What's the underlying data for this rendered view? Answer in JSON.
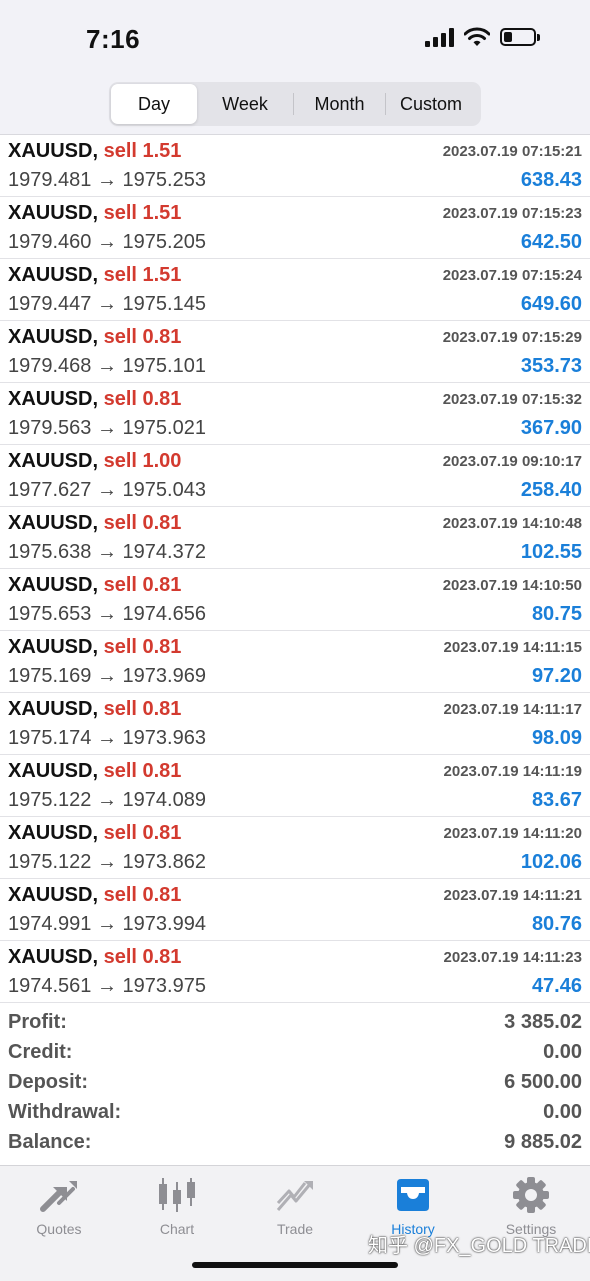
{
  "status_bar": {
    "time": "7:16"
  },
  "segments": {
    "tabs": [
      "Day",
      "Week",
      "Month",
      "Custom"
    ],
    "selected": "Day"
  },
  "trades": [
    {
      "symbol": "XAUUSD,",
      "side": "sell 1.51",
      "prices": "1979.481 → 1975.253",
      "datetime": "2023.07.19 07:15:21",
      "profit": "638.43"
    },
    {
      "symbol": "XAUUSD,",
      "side": "sell 1.51",
      "prices": "1979.460 → 1975.205",
      "datetime": "2023.07.19 07:15:23",
      "profit": "642.50"
    },
    {
      "symbol": "XAUUSD,",
      "side": "sell 1.51",
      "prices": "1979.447 → 1975.145",
      "datetime": "2023.07.19 07:15:24",
      "profit": "649.60"
    },
    {
      "symbol": "XAUUSD,",
      "side": "sell 0.81",
      "prices": "1979.468 → 1975.101",
      "datetime": "2023.07.19 07:15:29",
      "profit": "353.73"
    },
    {
      "symbol": "XAUUSD,",
      "side": "sell 0.81",
      "prices": "1979.563 → 1975.021",
      "datetime": "2023.07.19 07:15:32",
      "profit": "367.90"
    },
    {
      "symbol": "XAUUSD,",
      "side": "sell 1.00",
      "prices": "1977.627 → 1975.043",
      "datetime": "2023.07.19 09:10:17",
      "profit": "258.40"
    },
    {
      "symbol": "XAUUSD,",
      "side": "sell 0.81",
      "prices": "1975.638 → 1974.372",
      "datetime": "2023.07.19 14:10:48",
      "profit": "102.55"
    },
    {
      "symbol": "XAUUSD,",
      "side": "sell 0.81",
      "prices": "1975.653 → 1974.656",
      "datetime": "2023.07.19 14:10:50",
      "profit": "80.75"
    },
    {
      "symbol": "XAUUSD,",
      "side": "sell 0.81",
      "prices": "1975.169 → 1973.969",
      "datetime": "2023.07.19 14:11:15",
      "profit": "97.20"
    },
    {
      "symbol": "XAUUSD,",
      "side": "sell 0.81",
      "prices": "1975.174 → 1973.963",
      "datetime": "2023.07.19 14:11:17",
      "profit": "98.09"
    },
    {
      "symbol": "XAUUSD,",
      "side": "sell 0.81",
      "prices": "1975.122 → 1974.089",
      "datetime": "2023.07.19 14:11:19",
      "profit": "83.67"
    },
    {
      "symbol": "XAUUSD,",
      "side": "sell 0.81",
      "prices": "1975.122 → 1973.862",
      "datetime": "2023.07.19 14:11:20",
      "profit": "102.06"
    },
    {
      "symbol": "XAUUSD,",
      "side": "sell 0.81",
      "prices": "1974.991 → 1973.994",
      "datetime": "2023.07.19 14:11:21",
      "profit": "80.76"
    },
    {
      "symbol": "XAUUSD,",
      "side": "sell 0.81",
      "prices": "1974.561 → 1973.975",
      "datetime": "2023.07.19 14:11:23",
      "profit": "47.46"
    }
  ],
  "summary": [
    {
      "label": "Profit:",
      "value": "3 385.02"
    },
    {
      "label": "Credit:",
      "value": "0.00"
    },
    {
      "label": "Deposit:",
      "value": "6 500.00"
    },
    {
      "label": "Withdrawal:",
      "value": "0.00"
    },
    {
      "label": "Balance:",
      "value": "9 885.02"
    }
  ],
  "tab_bar": {
    "items": [
      {
        "label": "Quotes",
        "icon": "quotes-arrows-icon"
      },
      {
        "label": "Chart",
        "icon": "candlestick-chart-icon"
      },
      {
        "label": "Trade",
        "icon": "trade-line-icon"
      },
      {
        "label": "History",
        "icon": "history-tray-icon"
      },
      {
        "label": "Settings",
        "icon": "gear-icon"
      }
    ],
    "active": "History"
  },
  "watermark": "知乎 @FX_GOLD TRADER",
  "colors": {
    "sell": "#d33a2f",
    "profit": "#1a7fd9",
    "tab_active": "#1a7fd9",
    "tab_inactive": "#8e8e93",
    "battery_level": 0.3
  }
}
